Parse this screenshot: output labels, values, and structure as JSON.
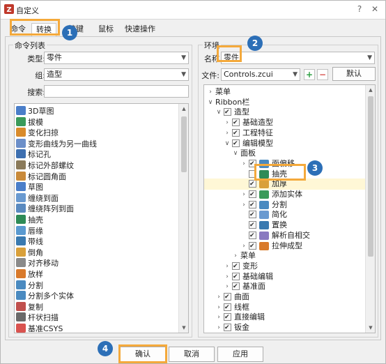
{
  "window": {
    "title": "自定义",
    "help": "?",
    "close": "✕"
  },
  "tabs": [
    {
      "label": "命令"
    },
    {
      "label": "转换"
    },
    {
      "label": "捷键"
    },
    {
      "label": "鼠标"
    },
    {
      "label": "快速操作"
    }
  ],
  "left": {
    "group_title": "命令列表",
    "type_label": "类型:",
    "type_value": "零件",
    "group_label": "组:",
    "group_value": "造型",
    "search_label": "搜索:",
    "search_value": "",
    "items": [
      {
        "label": "3D草图",
        "color": "#4a7ec9"
      },
      {
        "label": "拔模",
        "color": "#3a9a5a"
      },
      {
        "label": "变化扫掠",
        "color": "#d98b2b"
      },
      {
        "label": "变形曲线为另一曲线",
        "color": "#6c8fc9"
      },
      {
        "label": "标记孔",
        "color": "#3d6fb0"
      },
      {
        "label": "标记外部螺纹",
        "color": "#8a7a5a"
      },
      {
        "label": "标记圆角面",
        "color": "#c98a3a"
      },
      {
        "label": "草图",
        "color": "#4a7ec9"
      },
      {
        "label": "缠绕到面",
        "color": "#6a9ad0"
      },
      {
        "label": "缠绕阵列到面",
        "color": "#5a8ac0"
      },
      {
        "label": "抽壳",
        "color": "#2e8b57"
      },
      {
        "label": "唇缘",
        "color": "#5a9ad0"
      },
      {
        "label": "带线",
        "color": "#3a7ab0"
      },
      {
        "label": "倒角",
        "color": "#d9a03a"
      },
      {
        "label": "对齐移动",
        "color": "#8a8a8a"
      },
      {
        "label": "放样",
        "color": "#d97a2b"
      },
      {
        "label": "分割",
        "color": "#4a8ac0"
      },
      {
        "label": "分割多个实体",
        "color": "#4a8ac0"
      },
      {
        "label": "复制",
        "color": "#c0504d"
      },
      {
        "label": "杆状扫描",
        "color": "#6a6a6a"
      },
      {
        "label": "基准CSYS",
        "color": "#d9534f"
      }
    ]
  },
  "right": {
    "group_title": "环境",
    "name_label": "名称",
    "name_value": "零件",
    "file_label": "文件:",
    "file_value": "Controls.zcui",
    "add_icon": "+",
    "remove_icon": "−",
    "default_button": "默认",
    "tree": [
      {
        "label": "菜单",
        "expander": "right",
        "check": false
      },
      {
        "label": "Ribbon栏",
        "expander": "down",
        "check": false
      },
      {
        "label": "造型",
        "expander": "down",
        "check": true
      },
      {
        "label": "基础造型",
        "expander": "right",
        "check": true
      },
      {
        "label": "工程特征",
        "expander": "right",
        "check": true
      },
      {
        "label": "编辑模型",
        "expander": "down",
        "check": true
      },
      {
        "label": "面板",
        "expander": "down",
        "check": false
      },
      {
        "label": "面偏移",
        "expander": "right",
        "check": true,
        "icon": "#4a8ac0"
      },
      {
        "label": "抽壳",
        "expander": "",
        "check": false,
        "icon": "#2e8b57"
      },
      {
        "label": "加厚",
        "expander": "",
        "check": true,
        "icon": "#d9a03a"
      },
      {
        "label": "添加实体",
        "expander": "right",
        "check": true,
        "icon": "#3a9a5a"
      },
      {
        "label": "分割",
        "expander": "right",
        "check": true,
        "icon": "#4a8ac0"
      },
      {
        "label": "简化",
        "expander": "",
        "check": true,
        "icon": "#6a9ad0"
      },
      {
        "label": "置换",
        "expander": "",
        "check": true,
        "icon": "#3a7ab0"
      },
      {
        "label": "解析自相交",
        "expander": "",
        "check": true,
        "icon": "#8a7ac0"
      },
      {
        "label": "拉伸成型",
        "expander": "right",
        "check": true,
        "icon": "#d97a2b"
      },
      {
        "label": "菜单",
        "expander": "right",
        "check": false
      },
      {
        "label": "变形",
        "expander": "right",
        "check": true
      },
      {
        "label": "基础编辑",
        "expander": "right",
        "check": true
      },
      {
        "label": "基准面",
        "expander": "right",
        "check": true
      },
      {
        "label": "曲面",
        "expander": "right",
        "check": true
      },
      {
        "label": "线框",
        "expander": "right",
        "check": true
      },
      {
        "label": "直接编辑",
        "expander": "right",
        "check": true
      },
      {
        "label": "钣金",
        "expander": "right",
        "check": true
      }
    ]
  },
  "footer": {
    "ok": "确认",
    "cancel": "取消",
    "apply": "应用"
  },
  "callouts": [
    "1",
    "2",
    "3",
    "4"
  ]
}
